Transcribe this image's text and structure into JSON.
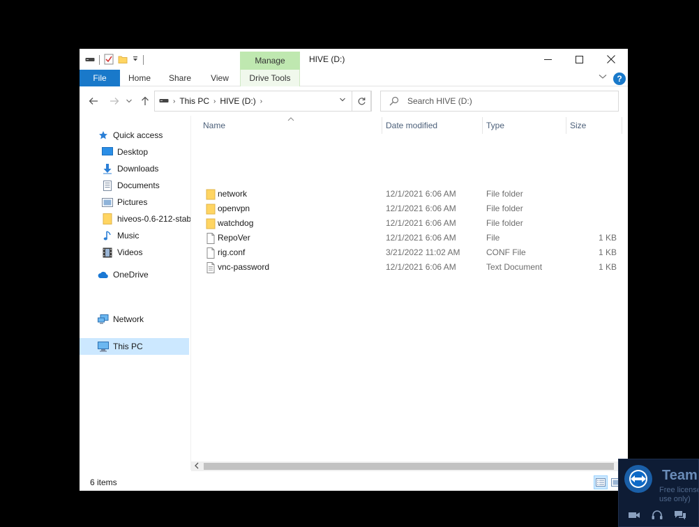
{
  "window": {
    "title": "HIVE (D:)",
    "manage_tab": "Manage"
  },
  "ribbon": {
    "tabs": [
      "File",
      "Home",
      "Share",
      "View",
      "Drive Tools"
    ]
  },
  "address": {
    "crumbs": [
      "This PC",
      "HIVE (D:)"
    ]
  },
  "search": {
    "placeholder": "Search HIVE (D:)"
  },
  "nav": {
    "quick_access": "Quick access",
    "items": [
      "Desktop",
      "Downloads",
      "Documents",
      "Pictures",
      "hiveos-0.6-212-stab",
      "Music",
      "Videos"
    ],
    "onedrive": "OneDrive",
    "this_pc": "This PC",
    "network": "Network"
  },
  "columns": {
    "name": "Name",
    "date": "Date modified",
    "type": "Type",
    "size": "Size"
  },
  "files": [
    {
      "name": "network",
      "date": "12/1/2021 6:06 AM",
      "type": "File folder",
      "size": "",
      "icon": "folder-icon"
    },
    {
      "name": "openvpn",
      "date": "12/1/2021 6:06 AM",
      "type": "File folder",
      "size": "",
      "icon": "folder-icon"
    },
    {
      "name": "watchdog",
      "date": "12/1/2021 6:06 AM",
      "type": "File folder",
      "size": "",
      "icon": "folder-icon"
    },
    {
      "name": "RepoVer",
      "date": "12/1/2021 6:06 AM",
      "type": "File",
      "size": "1 KB",
      "icon": "file-icon"
    },
    {
      "name": "rig.conf",
      "date": "3/21/2022 11:02 AM",
      "type": "CONF File",
      "size": "1 KB",
      "icon": "file-icon"
    },
    {
      "name": "vnc-password",
      "date": "12/1/2021 6:06 AM",
      "type": "Text Document",
      "size": "1 KB",
      "icon": "text-document-icon"
    }
  ],
  "status": {
    "count": "6 items"
  },
  "teamviewer": {
    "brand": "Team",
    "note_line1": "Free license",
    "note_line2": "use only)"
  },
  "colors": {
    "accent": "#1979ca",
    "manage_tab": "#bfe8b0",
    "selection": "#cce8ff",
    "folder": "#ffd562"
  }
}
